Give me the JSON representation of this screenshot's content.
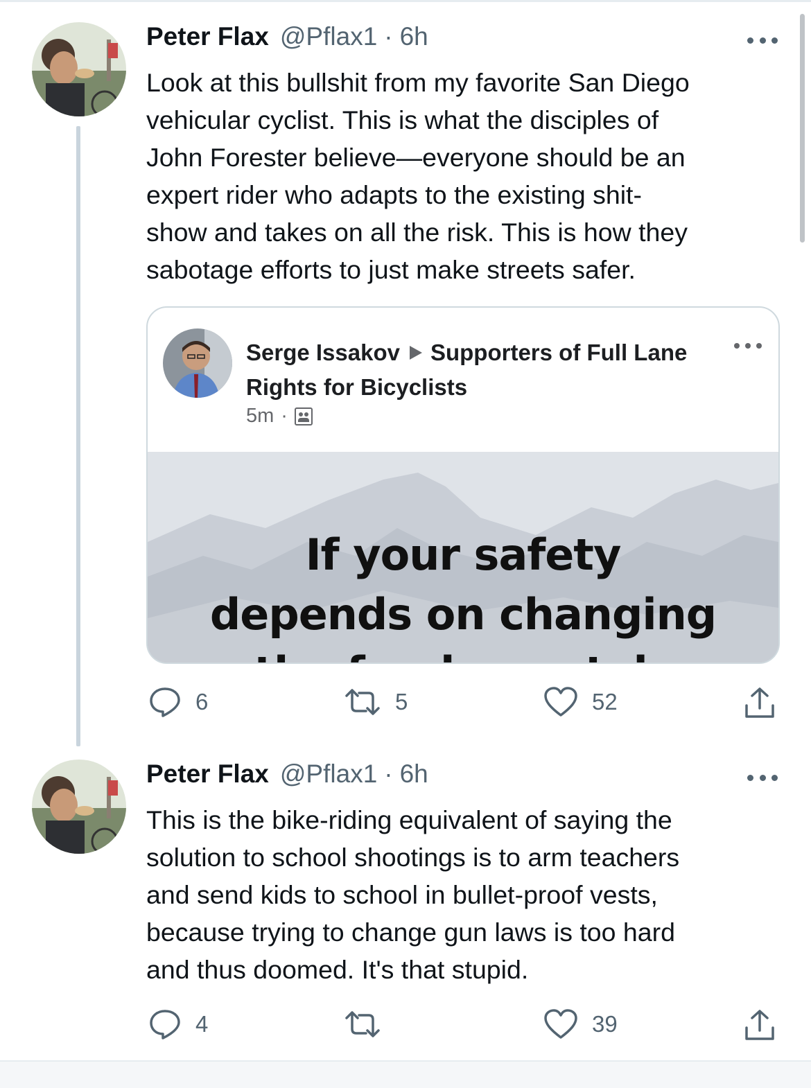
{
  "colors": {
    "text_primary": "#0f1419",
    "text_secondary": "#536471",
    "thread_line": "#c9d4dd",
    "card_border": "#cfd9de"
  },
  "tweets": [
    {
      "name": "Peter Flax",
      "handle": "@Pflax1",
      "separator": "·",
      "time": "6h",
      "text": "Look at this bullshit from my favorite San Diego\nvehicular cyclist. This is what the disciples of\nJohn Forester believe—everyone should be an\nexpert rider who adapts to the existing shit-\nshow and takes on all the risk. This is how they\nsabotage efforts to just make streets safer.",
      "quoted_post": {
        "author": "Serge Issakov",
        "group": "Supporters of Full Lane Rights for Bicyclists",
        "time": "5m",
        "separator": "·",
        "privacy_icon": "group-icon",
        "image_text": [
          "If your safety",
          "depends on changing",
          "the fundamentals"
        ]
      },
      "replies": "6",
      "retweets": "5",
      "likes": "52"
    },
    {
      "name": "Peter Flax",
      "handle": "@Pflax1",
      "separator": "·",
      "time": "6h",
      "text": "This is the bike-riding equivalent of saying the\nsolution to school shootings is to arm teachers\nand send kids to school in bullet-proof vests,\nbecause trying to change gun laws is too hard\nand thus doomed. It's that stupid.",
      "replies": "4",
      "retweets": "",
      "likes": "39"
    }
  ],
  "icons": {
    "reply": "reply-icon",
    "retweet": "retweet-icon",
    "like": "heart-icon",
    "share": "share-icon",
    "more": "more-icon"
  }
}
